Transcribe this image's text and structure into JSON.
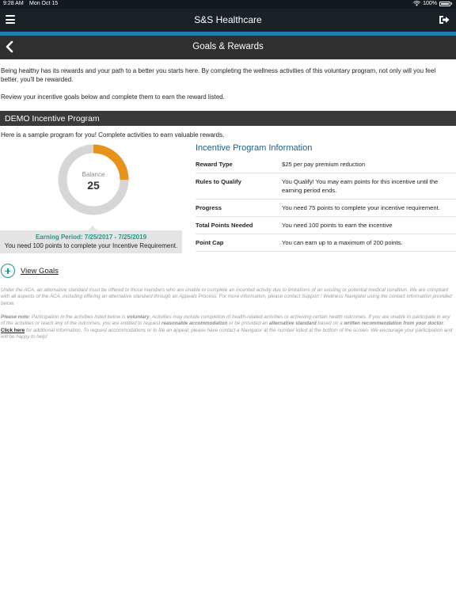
{
  "status_bar": {
    "time": "9:28 AM",
    "date": "Mon Oct 15",
    "battery": "100%",
    "icons": [
      "wifi-icon",
      "battery-icon"
    ]
  },
  "app_bar": {
    "title": "S&S Healthcare",
    "icons": [
      "menu-icon",
      "logout-icon"
    ]
  },
  "sub_header": {
    "title": "Goals & Rewards",
    "icon": "back-chevron-icon"
  },
  "colors": {
    "accent": "#1f7fb0",
    "teal": "#1a9a8a",
    "donut_filled": "#e8921c",
    "donut_remaining": "#d6d6d6",
    "header_blue": "#1b5e86"
  },
  "intro": {
    "paragraph1": "Being healthy has its rewards and your path to a better you starts here. By completing the wellness activities of this voluntary program, not only will you feel better, you'll be rewarded.",
    "paragraph2": "Review your incentive goals below and complete them to earn the reward listed."
  },
  "program": {
    "title": "DEMO Incentive Program",
    "description": "Here is a sample program for you! Complete activities to earn valuable rewards.",
    "balance_label": "Balance",
    "balance_value": "25",
    "progress_fraction": 0.25,
    "earning_period": "Earning Period: 7/25/2017 - 7/25/2019",
    "requirement_note": "You need 100 points to complete your Incentive Requirement."
  },
  "info": {
    "title": "Incentive Program Information",
    "rows": [
      {
        "key": "Reward Type",
        "value": "$25 per pay premium reduction"
      },
      {
        "key": "Rules to Qualify",
        "value": "You Qualify! You may earn points for this incentive until the earning period ends."
      },
      {
        "key": "Progress",
        "value": "You need 75 points to complete your incentive requirement."
      },
      {
        "key": "Total Points Needed",
        "value": "You need 100 points to earn the incentive"
      },
      {
        "key": "Point Cap",
        "value": "You can earn up to a maximum of 200 points."
      }
    ]
  },
  "view_goals": {
    "label": "View Goals",
    "icon": "plus-circle-icon"
  },
  "legal": {
    "aca_text": "Under the ACA, an alternative standard must be offered to those members who are unable to complete an incented activity due to limitations of an existing or potential medical condition. We are compliant with all aspects of the ACA, including offering an alternative standard through an Appeals Process. For more information, please contact Support / Wellness Navigator using the contact information provided below.",
    "note_label": "Please note:",
    "note_part1": " Participation in the activities listed below is ",
    "voluntary": "voluntary",
    "note_part2": ". Activities may include completion of health-related activities or achieving certain health outcomes. If you are unable to participate in any of the activities or reach any of the outcomes, you are entitled to request ",
    "reasonable_accommodation": "reasonable accommodation",
    "note_part3": " or be provided an ",
    "alternative_standard": "alternative standard",
    "note_part4": " based on a ",
    "written_recommendation": "written recommendation from your doctor",
    "note_part5": ".",
    "click_here": "Click here",
    "click_here_text": " for additional information. To request accommodations or to file an appeal, please have contact a Navigator at the number listed at the bottom of the screen. We encourage your participation and will be happy to help!"
  }
}
